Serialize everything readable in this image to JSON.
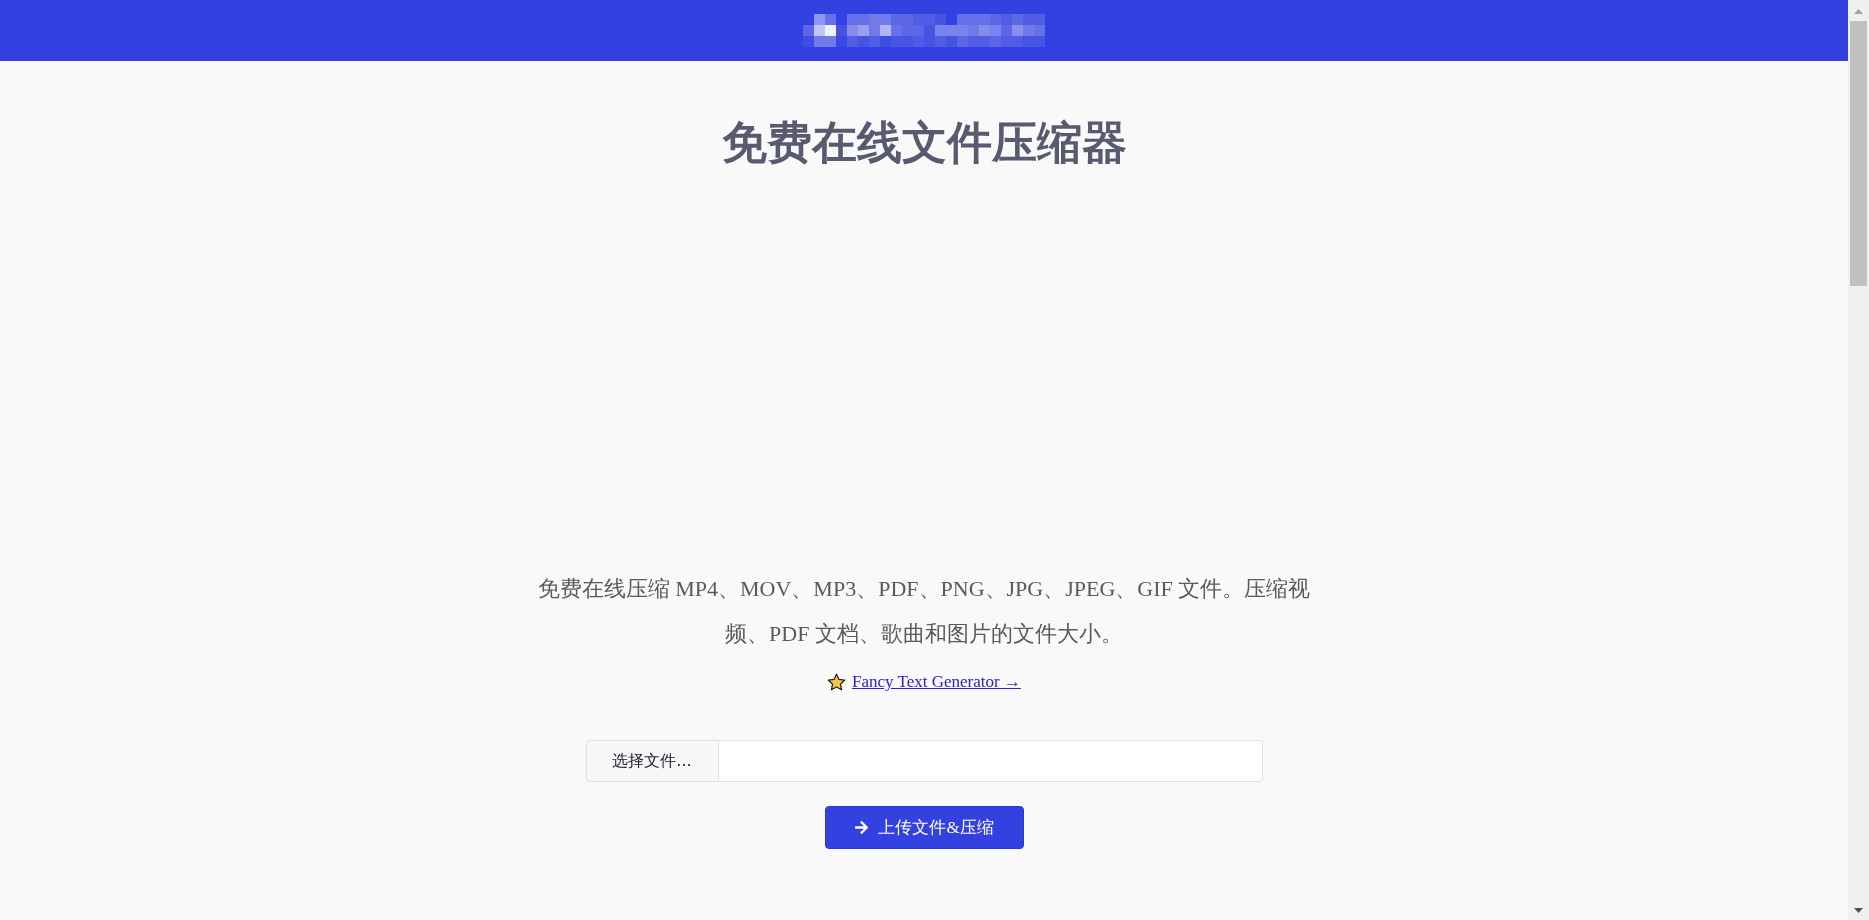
{
  "title": "免费在线文件压缩器",
  "description": "免费在线压缩 MP4、MOV、MP3、PDF、PNG、JPG、JPEG、GIF 文件。压缩视频、PDF 文档、歌曲和图片的文件大小。",
  "promo_link": {
    "label": "Fancy Text Generator →"
  },
  "file_picker": {
    "button_label": "选择文件..."
  },
  "upload_button": {
    "label": "上传文件&压缩"
  }
}
